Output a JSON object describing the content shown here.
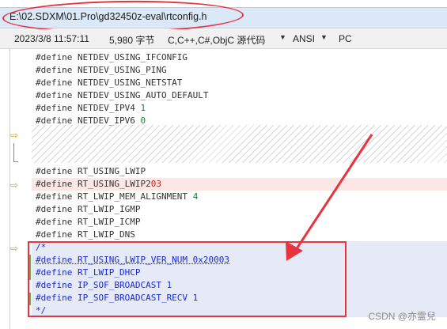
{
  "file": {
    "path": "E:\\02.SDXM\\01.Pro\\gd32450z-eval\\rtconfig.h"
  },
  "status": {
    "datetime": "2023/3/8 11:57:11",
    "size": "5,980 字节",
    "language": "C,C++,C#,ObjC 源代码",
    "encoding": "ANSI",
    "line_ending": "PC"
  },
  "code": {
    "l1": "#define NETDEV_USING_IFCONFIG",
    "l2": "#define NETDEV_USING_PING",
    "l3": "#define NETDEV_USING_NETSTAT",
    "l4": "#define NETDEV_USING_AUTO_DEFAULT",
    "l5_kw": "#define",
    "l5_name": " NETDEV_IPV4 ",
    "l5_val": "1",
    "l6_kw": "#define",
    "l6_name": " NETDEV_IPV6 ",
    "l6_val": "0",
    "l7": "#define RT_USING_LWIP",
    "l8_kw": "#define",
    "l8_name": " RT_USING_LWIP2",
    "l8_val": "03",
    "l9_kw": "#define",
    "l9_name": " RT_LWIP_MEM_ALIGNMENT ",
    "l9_val": "4",
    "l10": "#define RT_LWIP_IGMP",
    "l11": "#define RT_LWIP_ICMP",
    "l12": "#define RT_LWIP_DNS",
    "b1": "/*",
    "b2": "#define RT_USING_LWIP_VER_NUM 0x20003",
    "b3": "#define RT_LWIP_DHCP",
    "b4": "#define IP_SOF_BROADCAST 1",
    "b5": "#define IP_SOF_BROADCAST_RECV 1",
    "b6": "*/"
  },
  "watermark": "CSDN @亦霊兒",
  "colors": {
    "annotation": "#e8343e",
    "added_text": "#1a2ad0",
    "keyword": "#8b1c2b"
  }
}
